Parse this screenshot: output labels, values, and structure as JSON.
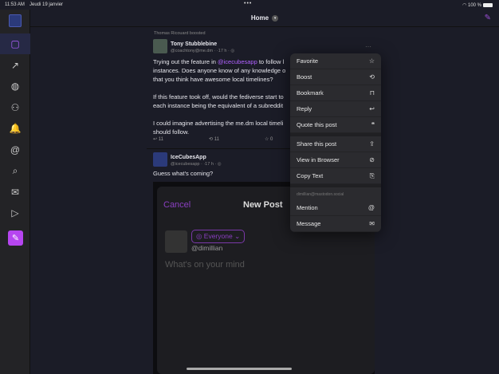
{
  "status": {
    "time": "11:53 AM",
    "date": "Jeudi 19 janvier",
    "dots": "•••",
    "battery": "100 %"
  },
  "header": {
    "title": "Home"
  },
  "sidebar": {
    "items": [
      {
        "name": "timeline",
        "icon": "▢"
      },
      {
        "name": "trending",
        "icon": "↗"
      },
      {
        "name": "explore",
        "icon": "◍"
      },
      {
        "name": "people",
        "icon": "⚇"
      },
      {
        "name": "notifications",
        "icon": "🔔"
      },
      {
        "name": "mentions",
        "icon": "@"
      },
      {
        "name": "search",
        "icon": "⌕"
      },
      {
        "name": "messages",
        "icon": "✉"
      },
      {
        "name": "settings",
        "icon": "▷"
      }
    ]
  },
  "posts": [
    {
      "boosted_by": "Thomas Ricouard boosted",
      "author": "Tony Stubblebine",
      "handle": "@coachtony@me.dm · ·17 h · ◎",
      "text_pre": "Trying out the feature in ",
      "mention": "@icecubesapp",
      "text_post": " to follow l\ninstances. Does anyone know of any knowledge o\nthat you think have awesome local timelines?\n\nIf this feature took off, would the fediverse start to\neach instance being the equivalent of a subreddit\n\nI could imagine advertising the me.dm local timeli\nshould follow.",
      "replies": "11",
      "boosts": "11",
      "favorites": "0"
    },
    {
      "author": "IceCubesApp",
      "handle": "@icecubesapp · ·17 h · ◎",
      "text": "Guess what's coming?",
      "preview": {
        "cancel": "Cancel",
        "title": "New Post",
        "visibility": "Everyone",
        "user": "@dimillian",
        "placeholder": "What's on your mind"
      }
    }
  ],
  "menu": {
    "group1": [
      {
        "label": "Favorite",
        "icon": "☆"
      },
      {
        "label": "Boost",
        "icon": "⟲"
      },
      {
        "label": "Bookmark",
        "icon": "⊓"
      },
      {
        "label": "Reply",
        "icon": "↩"
      },
      {
        "label": "Quote this post",
        "icon": "❝"
      }
    ],
    "group2": [
      {
        "label": "Share this post",
        "icon": "⇪"
      },
      {
        "label": "View in Browser",
        "icon": "⊘"
      },
      {
        "label": "Copy Text",
        "icon": "⎘"
      }
    ],
    "account_header": "dimillian@mastodon.social",
    "group3": [
      {
        "label": "Mention",
        "icon": "@"
      },
      {
        "label": "Message",
        "icon": "✉"
      }
    ]
  }
}
